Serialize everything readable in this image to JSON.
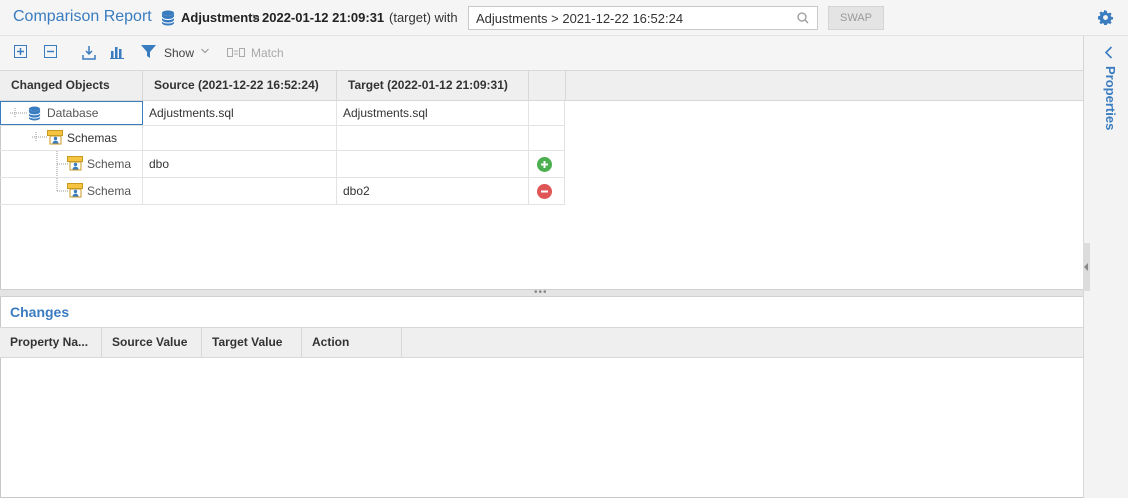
{
  "header": {
    "title": "Comparison Report",
    "db_name": "Adjustments",
    "separator": ">",
    "target_date": "2022-01-12 21:09:31",
    "target_suffix": "(target) with",
    "compare_value": "Adjustments > 2021-12-22 16:52:24",
    "swap_label": "SWAP"
  },
  "toolbar": {
    "show_label": "Show",
    "match_label": "Match"
  },
  "grid": {
    "columns": [
      "Changed Objects",
      "Source (2021-12-22 16:52:24)",
      "Target (2022-01-12 21:09:31)",
      ""
    ],
    "rows": [
      {
        "object": "Database",
        "source": "Adjustments.sql",
        "target": "Adjustments.sql",
        "action": ""
      },
      {
        "object": "Schemas",
        "source": "",
        "target": "",
        "action": ""
      },
      {
        "object": "Schema",
        "source": "dbo",
        "target": "",
        "action": "added"
      },
      {
        "object": "Schema",
        "source": "",
        "target": "dbo2",
        "action": "removed"
      }
    ]
  },
  "changes": {
    "title": "Changes",
    "columns": [
      "Property Na...",
      "Source Value",
      "Target Value",
      "Action"
    ]
  },
  "side_panel": {
    "label": "Properties"
  },
  "colors": {
    "accent": "#3a7cc0",
    "added": "#4caf50",
    "removed": "#e05555"
  }
}
